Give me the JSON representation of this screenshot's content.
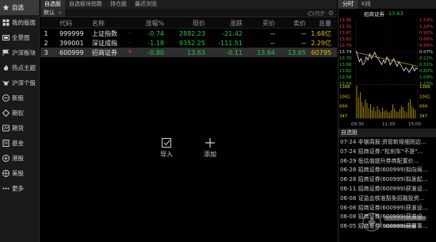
{
  "sidebar": {
    "items": [
      {
        "label": "自选",
        "icon": "star-icon",
        "active": true
      },
      {
        "label": "我的版面",
        "icon": "grid-icon",
        "active": false
      },
      {
        "label": "全景图",
        "icon": "panorama-icon",
        "active": false
      },
      {
        "label": "沪深板块",
        "icon": "flag-icon",
        "active": false
      },
      {
        "label": "热点主题",
        "icon": "flame-icon",
        "active": false
      },
      {
        "label": "沪深个股",
        "icon": "bull-icon",
        "active": false
      },
      {
        "label": "新股",
        "icon": "new-icon",
        "active": false
      },
      {
        "label": "期权",
        "icon": "options-icon",
        "active": false
      },
      {
        "label": "期货",
        "icon": "futures-icon",
        "active": false
      },
      {
        "label": "基金",
        "icon": "fund-icon",
        "active": false
      },
      {
        "label": "港股",
        "icon": "hk-icon",
        "active": false
      },
      {
        "label": "美股",
        "icon": "us-icon",
        "active": false
      },
      {
        "label": "更多",
        "icon": "more-icon",
        "active": false
      }
    ]
  },
  "top_tabs": [
    "自选股",
    "自选板块指数",
    "持仓股",
    "最近浏览"
  ],
  "sub_tab": {
    "label": "默认",
    "close": "×"
  },
  "sync_label": "同步",
  "table": {
    "headers": {
      "code": "代码",
      "name": "名称",
      "pct": "涨幅%",
      "price": "现价",
      "chg": "涨跌",
      "bid": "买价",
      "ask": "卖价",
      "vol": "总量"
    },
    "rows": [
      {
        "idx": "1",
        "code": "999999",
        "name": "上证指数",
        "flag": "·",
        "pct": "-0.74",
        "price": "2882.23",
        "chg": "-21.42",
        "bid": "--",
        "ask": "--",
        "vol": "1.68亿"
      },
      {
        "idx": "2",
        "code": "399001",
        "name": "深证成指",
        "flag": "·",
        "pct": "-1.18",
        "price": "9352.25",
        "chg": "-111.51",
        "bid": "--",
        "ask": "--",
        "vol": "2.29亿"
      },
      {
        "idx": "3",
        "code": "600999",
        "name": "招商证券",
        "flag": "R",
        "pct": "-0.80",
        "price": "13.63",
        "chg": "-0.11",
        "bid": "13.64",
        "ask": "13.65",
        "vol": "60795"
      }
    ]
  },
  "actions": {
    "import_label": "导入",
    "add_label": "添加"
  },
  "right_panel": {
    "tabs": [
      "分时",
      "K线"
    ],
    "stock_name": "招商证券",
    "stock_price": "13.63",
    "y_left": [
      "13.95",
      "13.91",
      "13.87",
      "13.83",
      "13.79",
      "13.74",
      "13.70",
      "13.66",
      "13.62",
      "13.58",
      "13.54"
    ],
    "y_right": [
      "1.53%",
      "1.24%",
      "0.95%",
      "0.66%",
      "0.36%",
      "0.07%",
      "0.22%",
      "0.51%",
      "0.80%",
      "1.09%",
      "1.15%"
    ],
    "vol_left": [
      "1388",
      "1041",
      "694",
      "347"
    ],
    "vol_right": [
      "1388",
      "1041",
      "694",
      "347"
    ],
    "times": [
      "09:30",
      "11:30",
      "15:00"
    ],
    "news_title": "自选股",
    "news": [
      "07-24 非银周报:资管新规细则边…",
      "07-24 招商证券:\"松刹车\"不是\"…",
      "06-29 低估值提升券商配置价…",
      "06-28 招商证券(600999)拟向局…",
      "06-28 招商证券(600999)拟发起…",
      "06-11 招商证券(600999)获准设…",
      "06-08 证监会核准豁免招融投资…",
      "06-08 招商证券(600999)获准设…",
      "06-08 招商证券(600999)获准设…",
      "06-05 招商证券(600999)获董事…"
    ]
  },
  "colors": {
    "up": "#f03c3c",
    "down": "#29c446",
    "volume": "#e0c000",
    "accent": "#e0c000"
  }
}
